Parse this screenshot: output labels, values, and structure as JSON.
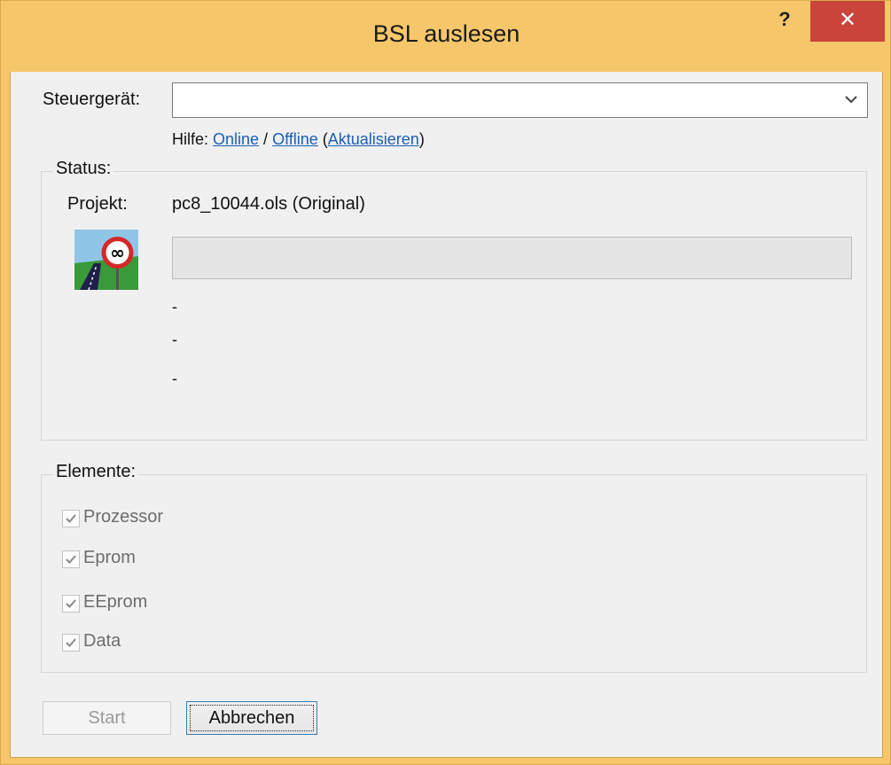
{
  "window": {
    "title": "BSL auslesen",
    "help_label": "?",
    "close_label": "✕",
    "accent_color": "#f6c76a",
    "close_color": "#c9443b"
  },
  "form": {
    "steuergeraet_label": "Steuergerät:",
    "steuergeraet_value": "",
    "hilfe": {
      "prefix": "Hilfe: ",
      "online": "Online",
      "sep": " / ",
      "offline": "Offline",
      "open_paren": " (",
      "aktualisieren": "Aktualisieren",
      "close_paren": ")"
    }
  },
  "status": {
    "group_title": "Status:",
    "projekt_label": "Projekt:",
    "projekt_value": "pc8_10044.ols (Original)",
    "progress": 0,
    "lines": [
      "-",
      "-",
      "-"
    ],
    "logo_icon": "no-speed-limit-road-sign-icon"
  },
  "elemente": {
    "group_title": "Elemente:",
    "items": [
      {
        "label": "Prozessor",
        "checked": true
      },
      {
        "label": "Eprom",
        "checked": true
      },
      {
        "label": "EEprom",
        "checked": true
      },
      {
        "label": "Data",
        "checked": true
      }
    ]
  },
  "buttons": {
    "start_label": "Start",
    "abbrechen_label": "Abbrechen"
  }
}
